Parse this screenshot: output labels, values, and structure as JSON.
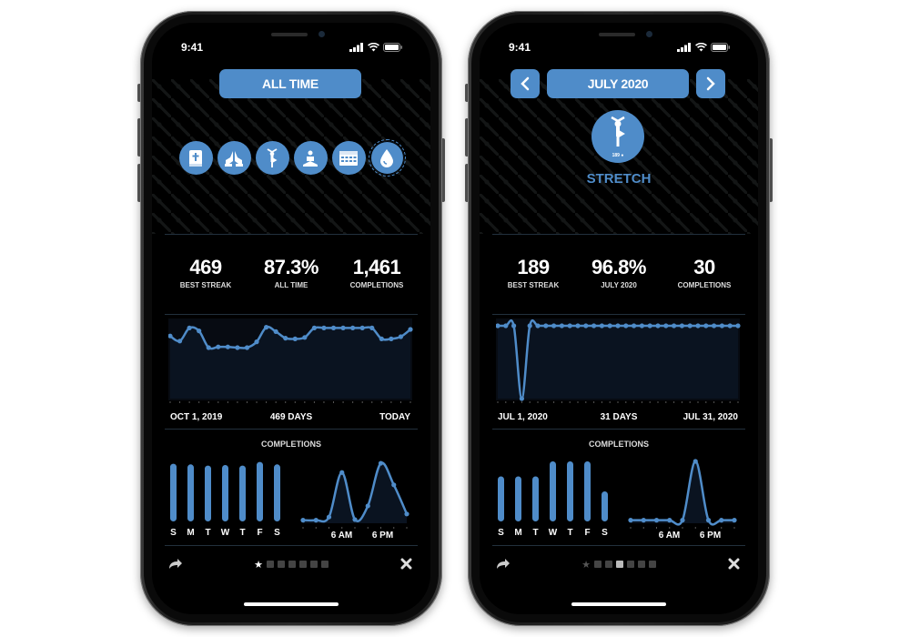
{
  "accent_color": "#4f8cc9",
  "phones": [
    {
      "status_time": "9:41",
      "header_label": "ALL TIME",
      "habits": [
        {
          "icon": "bible-icon"
        },
        {
          "icon": "praying-hands-icon"
        },
        {
          "icon": "yoga-tree-pose-icon"
        },
        {
          "icon": "meditation-icon"
        },
        {
          "icon": "calendar-icon"
        },
        {
          "icon": "water-drop-icon",
          "selected": true
        }
      ],
      "stats": [
        {
          "value": "469",
          "label": "BEST STREAK"
        },
        {
          "value": "87.3%",
          "label": "ALL TIME"
        },
        {
          "value": "1,461",
          "label": "COMPLETIONS"
        }
      ],
      "trend": {
        "start_label": "OCT 1, 2019",
        "middle_label": "469 DAYS",
        "end_label": "TODAY",
        "values": [
          0.86,
          0.79,
          0.97,
          0.93,
          0.7,
          0.71,
          0.71,
          0.7,
          0.7,
          0.78,
          0.98,
          0.92,
          0.83,
          0.82,
          0.84,
          0.97,
          0.97,
          0.97,
          0.97,
          0.97,
          0.97,
          0.97,
          0.82,
          0.82,
          0.85,
          0.95
        ]
      },
      "completions_title": "COMPLETIONS",
      "weekday": {
        "days": [
          "S",
          "M",
          "T",
          "W",
          "T",
          "F",
          "S"
        ],
        "values": [
          0.96,
          0.95,
          0.93,
          0.94,
          0.93,
          0.99,
          0.95
        ]
      },
      "hourly": {
        "labels": [
          "6 AM",
          "6 PM"
        ],
        "values": [
          0.05,
          0.05,
          0.1,
          0.82,
          0.06,
          0.28,
          0.97,
          0.62,
          0.15
        ]
      },
      "toolbar": {
        "share_icon": "share-arrow-icon",
        "close_icon": "close-x-icon",
        "page_icons": [
          "star-icon",
          "bible-icon",
          "praying-hands-icon",
          "yoga-icon",
          "meditation-icon",
          "calendar-icon",
          "water-drop-icon"
        ],
        "active_page": 0
      }
    },
    {
      "status_time": "9:41",
      "header_label": "JULY 2020",
      "prev_icon": "chevron-left-icon",
      "next_icon": "chevron-right-icon",
      "habit": {
        "icon": "yoga-tree-pose-icon",
        "badge": "189 ●",
        "name": "STRETCH"
      },
      "stats": [
        {
          "value": "189",
          "label": "BEST STREAK"
        },
        {
          "value": "96.8%",
          "label": "JULY 2020"
        },
        {
          "value": "30",
          "label": "COMPLETIONS"
        }
      ],
      "trend": {
        "start_label": "JUL 1, 2020",
        "middle_label": "31 DAYS",
        "end_label": "JUL 31, 2020",
        "values": [
          1,
          1,
          1,
          0,
          1,
          1,
          1,
          1,
          1,
          1,
          1,
          1,
          1,
          1,
          1,
          1,
          1,
          1,
          1,
          1,
          1,
          1,
          1,
          1,
          1,
          1,
          1,
          1,
          1,
          1,
          1
        ]
      },
      "completions_title": "COMPLETIONS",
      "weekday": {
        "days": [
          "S",
          "M",
          "T",
          "W",
          "T",
          "F",
          "S"
        ],
        "values": [
          0.75,
          0.75,
          0.75,
          1.0,
          1.0,
          1.0,
          0.5
        ]
      },
      "hourly": {
        "labels": [
          "6 AM",
          "6 PM"
        ],
        "values": [
          0.05,
          0.05,
          0.05,
          0.05,
          0.05,
          1.0,
          0.05,
          0.05,
          0.05
        ]
      },
      "toolbar": {
        "share_icon": "share-arrow-icon",
        "close_icon": "close-x-icon",
        "page_icons": [
          "star-icon",
          "bible-icon",
          "praying-hands-icon",
          "yoga-icon",
          "meditation-icon",
          "calendar-icon",
          "water-drop-icon"
        ],
        "active_page": 3
      }
    }
  ]
}
